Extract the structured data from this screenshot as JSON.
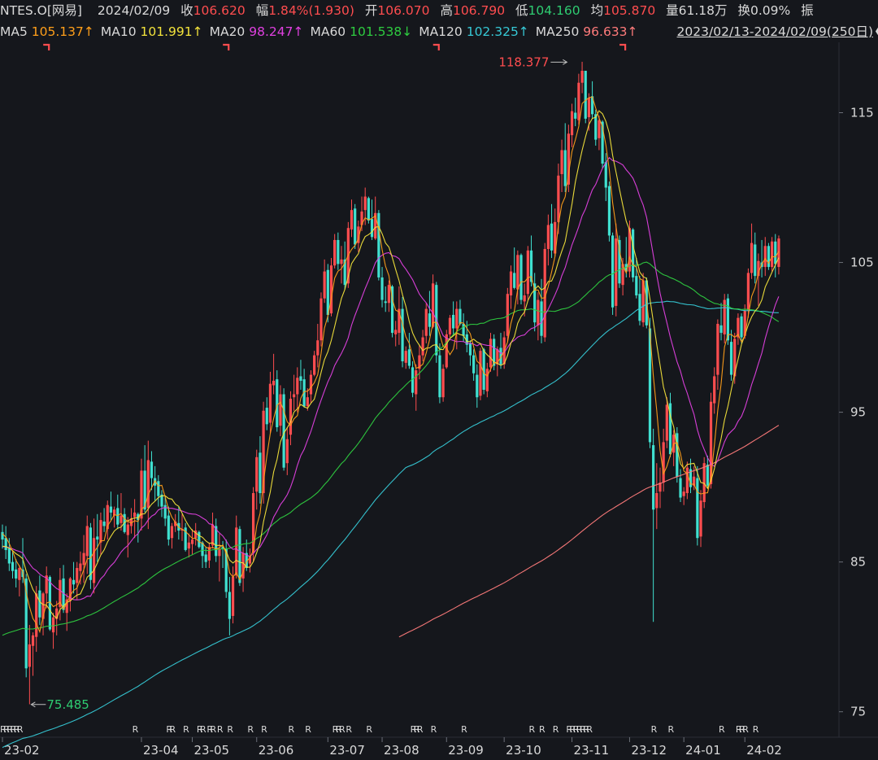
{
  "header": {
    "symbol": "NTES.O[网易]",
    "date": "2024/02/09",
    "close_label": "收",
    "close": "106.620",
    "change_label": "幅",
    "change": "1.84%(1.930)",
    "open_label": "开",
    "open": "106.070",
    "high_label": "高",
    "high": "106.790",
    "low_label": "低",
    "low": "104.160",
    "avg_label": "均",
    "avg": "105.870",
    "vol_label": "量",
    "volume": "61.18万",
    "turn_label": "换",
    "turnover": "0.09%",
    "amp_label": "振"
  },
  "ma_bar": {
    "items": [
      {
        "label": "MA5",
        "value": "105.137",
        "arrow": "↑",
        "color": "#ff9f1a"
      },
      {
        "label": "MA10",
        "value": "101.991",
        "arrow": "↑",
        "color": "#f3e33b"
      },
      {
        "label": "MA20",
        "value": "98.247",
        "arrow": "↑",
        "color": "#e040e0"
      },
      {
        "label": "MA60",
        "value": "101.538",
        "arrow": "↓",
        "color": "#2ecc40"
      },
      {
        "label": "MA120",
        "value": "102.325",
        "arrow": "↑",
        "color": "#36c9d6"
      },
      {
        "label": "MA250",
        "value": "96.633",
        "arrow": "↑",
        "color": "#ff7b7b"
      }
    ],
    "range": "2023/02/13-2024/02/09(250日)",
    "collapse_icon": "chevron-left-icon"
  },
  "colors": {
    "up": "#ff4d4f",
    "down": "#40e0d0",
    "background": "#15171c",
    "grid": "#2b2e36",
    "text": "#d9d9d9",
    "high_marker": "#ff4d4f",
    "low_marker": "#2ecc71"
  },
  "chart_data": {
    "type": "candlestick",
    "y_ticks": [
      75,
      85,
      95,
      105,
      115
    ],
    "ylim": [
      73.3,
      119.7
    ],
    "x_labels": [
      "23-02",
      "23-04",
      "23-05",
      "23-06",
      "23-07",
      "23-08",
      "23-09",
      "23-10",
      "23-11",
      "23-12",
      "24-01",
      "24-02"
    ],
    "x_label_index": [
      0,
      41,
      56,
      75,
      96,
      112,
      131,
      148,
      168,
      185,
      201,
      219
    ],
    "high_annotation": {
      "value": "118.377",
      "index": 167
    },
    "low_annotation": {
      "value": "75.485",
      "index": 8
    },
    "r_marker_label": "R",
    "r_markers": [
      0,
      1,
      2,
      3,
      4,
      5,
      39,
      49,
      50,
      54,
      58,
      59,
      61,
      62,
      64,
      67,
      73,
      77,
      85,
      90,
      98,
      99,
      100,
      102,
      108,
      121,
      122,
      123,
      127,
      136,
      156,
      159,
      163,
      167,
      168,
      169,
      170,
      171,
      172,
      173,
      192,
      197,
      212,
      217,
      218,
      219,
      222
    ],
    "period_markers": [
      13,
      66,
      128,
      183
    ],
    "candles": [
      [
        87.0,
        87.5,
        85.9,
        86.5
      ],
      [
        86.6,
        87.4,
        85.2,
        85.8
      ],
      [
        85.9,
        86.6,
        84.4,
        84.9
      ],
      [
        85.0,
        85.8,
        83.9,
        84.4
      ],
      [
        84.5,
        85.2,
        83.3,
        83.9
      ],
      [
        83.8,
        84.8,
        82.7,
        84.6
      ],
      [
        84.5,
        86.6,
        83.6,
        84.0
      ],
      [
        83.9,
        84.2,
        77.3,
        77.9
      ],
      [
        78.0,
        80.8,
        75.5,
        79.5
      ],
      [
        79.4,
        80.3,
        77.4,
        80.1
      ],
      [
        80.0,
        83.4,
        79.0,
        82.9
      ],
      [
        83.1,
        84.1,
        80.8,
        81.3
      ],
      [
        81.2,
        83.0,
        80.1,
        82.9
      ],
      [
        82.9,
        84.7,
        81.9,
        84.1
      ],
      [
        84.0,
        84.1,
        80.4,
        80.5
      ],
      [
        80.3,
        81.6,
        79.2,
        81.3
      ],
      [
        81.2,
        82.4,
        80.1,
        81.9
      ],
      [
        82.0,
        84.6,
        81.1,
        83.8
      ],
      [
        83.9,
        84.8,
        81.6,
        81.8
      ],
      [
        81.6,
        82.9,
        80.4,
        82.5
      ],
      [
        82.4,
        84.0,
        81.7,
        83.9
      ],
      [
        83.8,
        85.0,
        82.9,
        83.5
      ],
      [
        83.6,
        85.0,
        82.5,
        84.6
      ],
      [
        84.4,
        85.7,
        83.5,
        84.9
      ],
      [
        84.8,
        86.8,
        83.6,
        85.6
      ],
      [
        85.4,
        88.1,
        84.2,
        87.4
      ],
      [
        87.3,
        87.6,
        83.2,
        83.8
      ],
      [
        83.6,
        87.9,
        82.9,
        86.6
      ],
      [
        86.7,
        88.2,
        85.0,
        86.5
      ],
      [
        86.3,
        88.3,
        85.5,
        87.8
      ],
      [
        87.7,
        88.6,
        87.0,
        87.4
      ],
      [
        87.2,
        89.1,
        86.5,
        88.8
      ],
      [
        88.7,
        89.7,
        87.8,
        88.3
      ],
      [
        88.1,
        88.7,
        87.3,
        88.5
      ],
      [
        88.6,
        89.5,
        87.2,
        87.5
      ],
      [
        87.6,
        89.6,
        87.1,
        88.1
      ],
      [
        88.2,
        88.6,
        86.9,
        87.0
      ],
      [
        86.8,
        88.0,
        85.3,
        87.5
      ],
      [
        87.4,
        88.6,
        86.9,
        87.9
      ],
      [
        88.0,
        89.2,
        86.6,
        88.3
      ],
      [
        88.2,
        88.3,
        86.3,
        87.8
      ],
      [
        87.9,
        91.9,
        87.1,
        91.1
      ],
      [
        91.1,
        92.8,
        88.3,
        88.5
      ],
      [
        88.6,
        93.1,
        87.2,
        91.8
      ],
      [
        91.7,
        92.4,
        89.8,
        90.6
      ],
      [
        90.6,
        91.4,
        89.1,
        90.1
      ],
      [
        90.4,
        90.8,
        88.7,
        89.4
      ],
      [
        89.5,
        89.8,
        88.0,
        88.7
      ],
      [
        88.8,
        89.4,
        87.4,
        87.9
      ],
      [
        88.1,
        88.7,
        86.1,
        86.5
      ],
      [
        86.6,
        87.6,
        85.9,
        87.4
      ],
      [
        87.4,
        88.2,
        87.0,
        87.7
      ],
      [
        87.6,
        88.7,
        86.5,
        87.1
      ],
      [
        87.1,
        88.2,
        86.4,
        87.2
      ],
      [
        87.3,
        87.6,
        85.7,
        85.8
      ],
      [
        85.9,
        86.9,
        85.3,
        86.3
      ],
      [
        86.2,
        87.2,
        85.5,
        86.5
      ],
      [
        86.6,
        87.6,
        86.1,
        87.1
      ],
      [
        87.0,
        87.1,
        85.9,
        86.0
      ],
      [
        86.3,
        86.4,
        84.6,
        85.4
      ],
      [
        85.5,
        86.0,
        84.6,
        85.0
      ],
      [
        85.1,
        86.3,
        84.6,
        86.0
      ],
      [
        86.1,
        88.3,
        85.9,
        87.5
      ],
      [
        87.4,
        87.9,
        85.0,
        85.4
      ],
      [
        85.4,
        86.9,
        83.7,
        85.9
      ],
      [
        86.0,
        86.4,
        84.6,
        85.9
      ],
      [
        85.9,
        86.5,
        82.6,
        83.0
      ],
      [
        83.0,
        84.0,
        80.1,
        81.2
      ],
      [
        81.4,
        84.7,
        80.9,
        84.0
      ],
      [
        84.1,
        88.1,
        83.9,
        87.3
      ],
      [
        87.2,
        87.4,
        83.4,
        83.6
      ],
      [
        83.9,
        86.0,
        83.0,
        85.6
      ],
      [
        85.6,
        86.5,
        84.4,
        84.6
      ],
      [
        84.9,
        85.9,
        84.3,
        85.4
      ],
      [
        85.6,
        90.0,
        85.0,
        89.6
      ],
      [
        89.7,
        92.5,
        88.5,
        92.0
      ],
      [
        92.3,
        93.4,
        88.9,
        89.6
      ],
      [
        89.6,
        95.7,
        88.9,
        95.1
      ],
      [
        95.3,
        96.0,
        93.8,
        94.2
      ],
      [
        94.3,
        97.7,
        93.6,
        96.9
      ],
      [
        96.8,
        98.9,
        96.2,
        97.1
      ],
      [
        97.2,
        97.8,
        93.7,
        94.0
      ],
      [
        94.1,
        96.8,
        93.4,
        96.2
      ],
      [
        96.2,
        96.6,
        91.1,
        91.3
      ],
      [
        91.6,
        94.0,
        90.8,
        93.2
      ],
      [
        93.5,
        96.4,
        92.8,
        95.9
      ],
      [
        96.0,
        97.5,
        95.1,
        96.2
      ],
      [
        96.2,
        98.0,
        95.0,
        97.3
      ],
      [
        97.4,
        98.5,
        96.5,
        97.1
      ],
      [
        97.2,
        97.9,
        95.3,
        95.4
      ],
      [
        95.4,
        96.6,
        95.1,
        96.0
      ],
      [
        96.2,
        97.8,
        95.6,
        97.5
      ],
      [
        97.5,
        99.1,
        97.4,
        98.8
      ],
      [
        98.8,
        100.9,
        98.0,
        99.8
      ],
      [
        99.8,
        103.0,
        99.4,
        102.6
      ],
      [
        102.6,
        105.2,
        102.3,
        104.4
      ],
      [
        104.5,
        104.9,
        101.0,
        101.5
      ],
      [
        101.6,
        105.3,
        101.4,
        104.8
      ],
      [
        104.8,
        106.9,
        104.6,
        106.5
      ],
      [
        106.5,
        107.0,
        104.5,
        104.9
      ],
      [
        104.9,
        106.1,
        103.6,
        105.2
      ],
      [
        105.2,
        106.4,
        103.2,
        103.5
      ],
      [
        103.6,
        107.7,
        103.3,
        107.3
      ],
      [
        107.2,
        109.2,
        106.7,
        108.5
      ],
      [
        108.6,
        108.9,
        105.9,
        106.2
      ],
      [
        106.3,
        107.8,
        105.7,
        107.4
      ],
      [
        107.5,
        109.4,
        107.1,
        108.4
      ],
      [
        108.5,
        110.0,
        107.5,
        109.4
      ],
      [
        109.3,
        109.4,
        107.6,
        107.8
      ],
      [
        107.9,
        109.2,
        106.5,
        106.7
      ],
      [
        106.6,
        109.4,
        106.5,
        108.3
      ],
      [
        108.3,
        108.5,
        103.8,
        104.0
      ],
      [
        104.0,
        104.7,
        102.0,
        102.5
      ],
      [
        102.4,
        103.4,
        101.7,
        102.3
      ],
      [
        102.3,
        103.8,
        101.7,
        103.5
      ],
      [
        103.4,
        103.5,
        100.0,
        100.3
      ],
      [
        100.2,
        101.1,
        99.4,
        100.5
      ],
      [
        100.3,
        103.4,
        99.5,
        101.9
      ],
      [
        101.9,
        102.7,
        98.0,
        98.4
      ],
      [
        98.3,
        99.4,
        97.9,
        99.1
      ],
      [
        99.2,
        100.3,
        97.9,
        98.1
      ],
      [
        98.0,
        98.4,
        96.0,
        96.3
      ],
      [
        96.2,
        98.2,
        95.1,
        97.8
      ],
      [
        97.9,
        99.5,
        97.2,
        98.8
      ],
      [
        98.8,
        100.5,
        98.4,
        100.0
      ],
      [
        100.1,
        102.3,
        99.6,
        101.9
      ],
      [
        101.6,
        103.1,
        100.1,
        100.7
      ],
      [
        100.7,
        104.2,
        100.6,
        103.6
      ],
      [
        103.5,
        103.7,
        98.3,
        98.8
      ],
      [
        98.8,
        99.6,
        95.6,
        96.0
      ],
      [
        96.0,
        98.2,
        95.7,
        97.9
      ],
      [
        98.0,
        100.5,
        97.9,
        100.2
      ],
      [
        100.2,
        101.5,
        99.8,
        101.3
      ],
      [
        101.5,
        102.4,
        100.1,
        100.6
      ],
      [
        100.6,
        102.4,
        99.2,
        101.9
      ],
      [
        101.9,
        102.5,
        100.8,
        100.9
      ],
      [
        100.9,
        101.6,
        99.7,
        100.1
      ],
      [
        100.2,
        101.1,
        99.0,
        99.5
      ],
      [
        99.6,
        99.8,
        98.1,
        98.8
      ],
      [
        98.8,
        99.2,
        97.1,
        97.6
      ],
      [
        97.5,
        98.2,
        95.3,
        96.0
      ],
      [
        96.1,
        99.3,
        95.8,
        99.1
      ],
      [
        99.2,
        99.3,
        96.2,
        96.5
      ],
      [
        96.4,
        98.3,
        96.0,
        97.9
      ],
      [
        98.0,
        100.3,
        97.7,
        99.9
      ],
      [
        99.9,
        100.2,
        97.8,
        98.1
      ],
      [
        98.2,
        99.4,
        97.4,
        99.2
      ],
      [
        99.3,
        100.3,
        97.9,
        98.2
      ],
      [
        98.2,
        100.4,
        97.9,
        100.0
      ],
      [
        100.1,
        103.3,
        99.7,
        102.9
      ],
      [
        102.8,
        104.8,
        101.9,
        104.4
      ],
      [
        104.3,
        106.0,
        103.2,
        103.3
      ],
      [
        103.2,
        105.8,
        102.2,
        105.5
      ],
      [
        105.5,
        105.6,
        102.2,
        102.5
      ],
      [
        102.4,
        103.6,
        101.4,
        102.8
      ],
      [
        102.9,
        106.1,
        102.5,
        105.8
      ],
      [
        105.8,
        106.8,
        103.4,
        103.7
      ],
      [
        103.6,
        104.3,
        100.4,
        101.0
      ],
      [
        100.8,
        103.0,
        99.8,
        102.5
      ],
      [
        102.4,
        103.9,
        99.6,
        100.1
      ],
      [
        100.0,
        106.3,
        99.7,
        105.9
      ],
      [
        105.9,
        108.2,
        104.8,
        107.5
      ],
      [
        107.6,
        108.9,
        105.3,
        105.8
      ],
      [
        105.6,
        108.6,
        105.4,
        107.7
      ],
      [
        107.7,
        111.6,
        106.9,
        110.8
      ],
      [
        110.9,
        113.2,
        109.7,
        112.5
      ],
      [
        112.5,
        114.3,
        109.7,
        110.1
      ],
      [
        110.2,
        114.2,
        109.7,
        113.6
      ],
      [
        113.5,
        115.6,
        112.7,
        115.1
      ],
      [
        115.0,
        116.0,
        114.1,
        114.6
      ],
      [
        114.5,
        117.6,
        114.2,
        117.0
      ],
      [
        117.0,
        118.4,
        116.3,
        117.8
      ],
      [
        117.8,
        117.8,
        114.3,
        114.6
      ],
      [
        114.7,
        116.3,
        113.8,
        116.0
      ],
      [
        116.1,
        117.1,
        114.6,
        114.9
      ],
      [
        114.9,
        115.2,
        112.8,
        113.2
      ],
      [
        113.3,
        114.8,
        112.5,
        114.5
      ],
      [
        114.4,
        114.5,
        111.3,
        111.6
      ],
      [
        111.7,
        112.3,
        109.1,
        110.0
      ],
      [
        110.1,
        110.4,
        106.4,
        106.8
      ],
      [
        106.8,
        107.0,
        101.5,
        102.0
      ],
      [
        102.1,
        107.6,
        101.4,
        106.6
      ],
      [
        106.5,
        106.8,
        103.3,
        103.6
      ],
      [
        103.5,
        105.3,
        102.8,
        104.9
      ],
      [
        104.9,
        106.7,
        104.0,
        104.4
      ],
      [
        104.4,
        107.8,
        104.0,
        107.3
      ],
      [
        107.2,
        107.3,
        103.7,
        104.0
      ],
      [
        104.1,
        105.3,
        102.6,
        102.8
      ],
      [
        102.9,
        104.1,
        100.8,
        101.1
      ],
      [
        101.0,
        104.3,
        100.7,
        103.8
      ],
      [
        103.8,
        104.0,
        100.6,
        100.8
      ],
      [
        100.6,
        101.3,
        92.6,
        93.0
      ],
      [
        92.8,
        93.9,
        81.0,
        88.5
      ],
      [
        88.6,
        91.6,
        87.2,
        89.6
      ],
      [
        89.7,
        91.3,
        88.6,
        90.3
      ],
      [
        90.3,
        93.9,
        89.7,
        93.0
      ],
      [
        93.1,
        96.0,
        92.6,
        95.5
      ],
      [
        95.6,
        96.3,
        92.0,
        92.2
      ],
      [
        92.3,
        93.8,
        91.4,
        93.5
      ],
      [
        93.6,
        94.0,
        90.3,
        90.7
      ],
      [
        90.6,
        91.2,
        89.0,
        89.3
      ],
      [
        89.4,
        90.0,
        88.8,
        89.7
      ],
      [
        89.6,
        91.7,
        89.2,
        91.3
      ],
      [
        91.2,
        91.9,
        89.6,
        90.0
      ],
      [
        90.1,
        91.4,
        89.8,
        90.7
      ],
      [
        90.6,
        91.4,
        86.1,
        86.6
      ],
      [
        86.7,
        89.8,
        86.0,
        89.1
      ],
      [
        89.0,
        92.0,
        88.6,
        91.6
      ],
      [
        91.5,
        92.1,
        89.9,
        90.1
      ],
      [
        90.2,
        96.3,
        89.9,
        95.7
      ],
      [
        95.6,
        98.0,
        94.9,
        97.4
      ],
      [
        97.5,
        101.2,
        96.5,
        100.9
      ],
      [
        100.8,
        102.3,
        99.8,
        100.3
      ],
      [
        100.2,
        102.9,
        99.6,
        102.5
      ],
      [
        102.6,
        102.9,
        99.5,
        99.8
      ],
      [
        99.7,
        100.5,
        97.1,
        97.5
      ],
      [
        97.4,
        100.3,
        96.9,
        99.9
      ],
      [
        100.0,
        101.6,
        99.5,
        101.3
      ],
      [
        101.4,
        101.6,
        99.6,
        100.0
      ],
      [
        100.1,
        102.2,
        99.9,
        101.8
      ],
      [
        101.8,
        104.6,
        101.3,
        104.3
      ],
      [
        104.3,
        107.6,
        103.9,
        106.3
      ],
      [
        106.2,
        107.0,
        103.6,
        104.1
      ],
      [
        104.1,
        105.6,
        102.1,
        105.1
      ],
      [
        105.0,
        106.5,
        104.0,
        104.7
      ],
      [
        104.7,
        106.7,
        104.1,
        106.1
      ],
      [
        106.1,
        106.3,
        104.5,
        104.7
      ],
      [
        104.7,
        106.7,
        104.4,
        106.4
      ],
      [
        106.4,
        106.9,
        104.0,
        104.9
      ],
      [
        104.7,
        106.8,
        104.2,
        106.6
      ]
    ]
  }
}
